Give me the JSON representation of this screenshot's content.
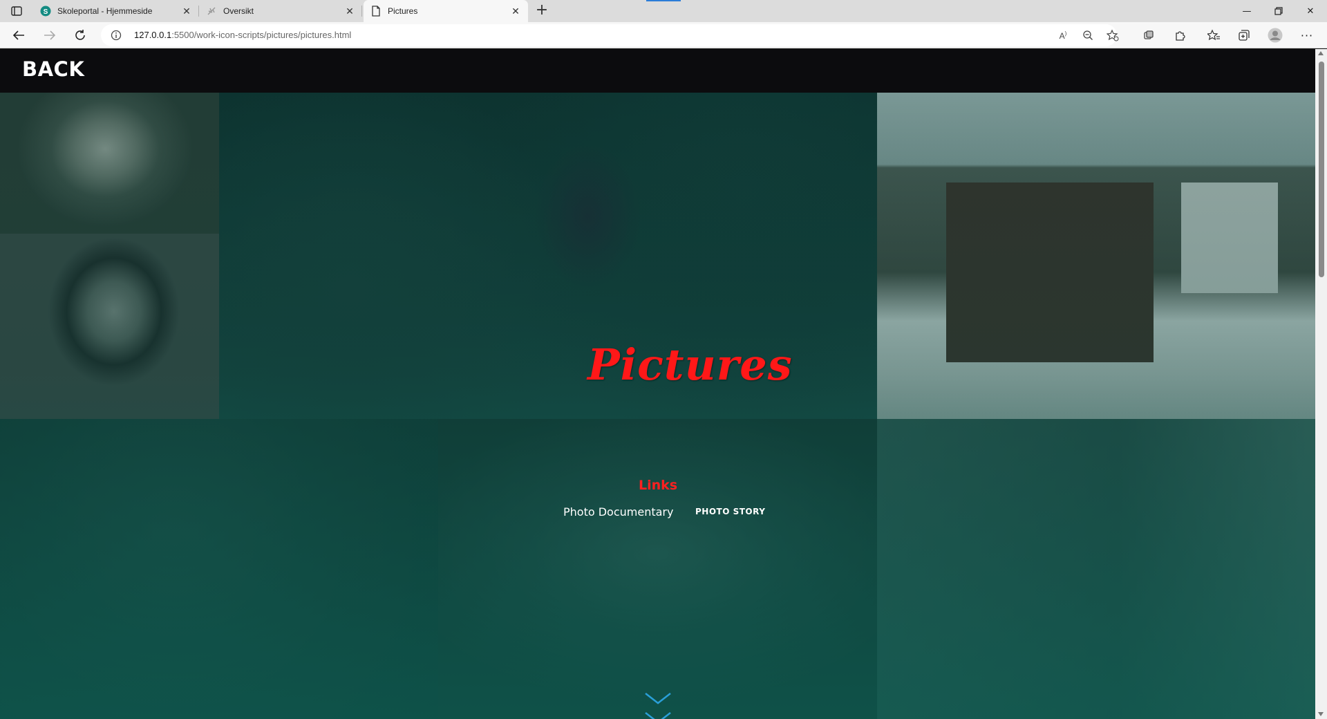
{
  "browser": {
    "tabs": [
      {
        "label": "Skoleportal - Hjemmeside",
        "favicon": "sharepoint-s-icon",
        "active": false
      },
      {
        "label": "Oversikt",
        "favicon": "leaf-icon",
        "active": false
      },
      {
        "label": "Pictures",
        "favicon": "page-icon",
        "active": true
      }
    ],
    "address": {
      "host": "127.0.0.1",
      "path": ":5500/work-icon-scripts/pictures/pictures.html"
    }
  },
  "page": {
    "back_label": "BACK",
    "hero_title": "Pictures",
    "links_heading": "Links",
    "links": [
      {
        "label": "Photo Documentary"
      },
      {
        "label": "PHOTO STORY"
      }
    ]
  },
  "colors": {
    "accent_red": "#ff1818",
    "topbar": "#0c0c0e",
    "chevron_blue": "#2a9fd8"
  }
}
